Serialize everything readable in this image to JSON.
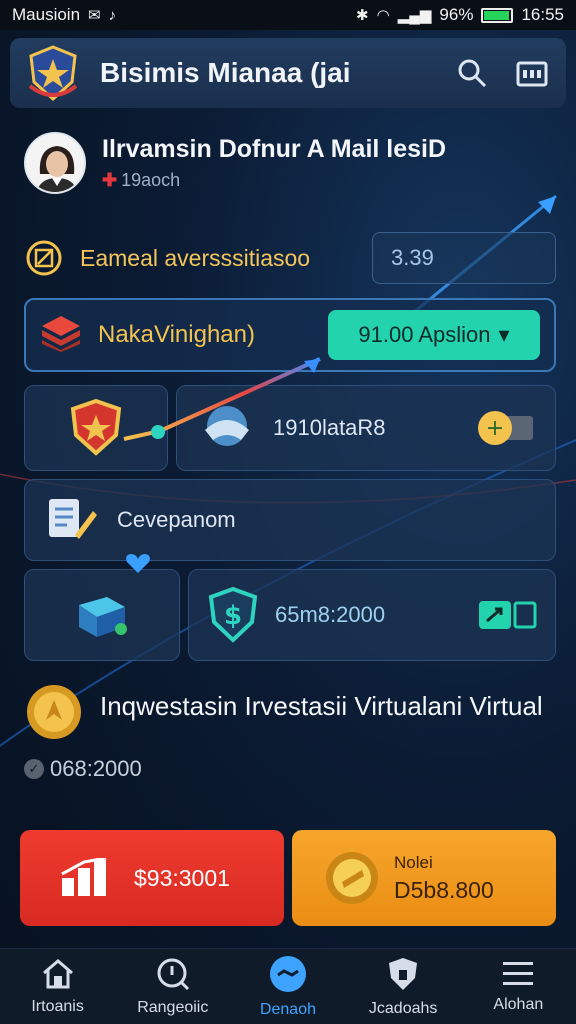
{
  "status_bar": {
    "carrier": "Mausioin",
    "battery": "96%",
    "time": "16:55"
  },
  "header": {
    "title": "Bisimis Mianaa (jai"
  },
  "profile": {
    "name": "Ilrvamsin Dofnur A Mail lesiD",
    "sub": "19aoch"
  },
  "earnings": {
    "label": "Eameal aversssitiasoo",
    "value": "3.39"
  },
  "selector": {
    "label": "NakaVinighan)",
    "button_label": "91.00 Apslion"
  },
  "tiles": {
    "amount_label": "1910lataR8",
    "cevepanom_label": "Cevepanom",
    "balance_label": "65m8:2000"
  },
  "investment": {
    "title": "Inqwestasin Irvestasii Virtualani Virtual",
    "amount": "068:2000"
  },
  "actions": {
    "red_value": "$93:3001",
    "orange_caption": "Nolei",
    "orange_value": "D5b8.800"
  },
  "nav": {
    "items": [
      {
        "label": "Irtoanis"
      },
      {
        "label": "Rangeoiic"
      },
      {
        "label": "Denaoh"
      },
      {
        "label": "Jcadoahs"
      },
      {
        "label": "Alohan"
      }
    ]
  },
  "colors": {
    "accent_teal": "#23d3ad",
    "accent_gold": "#f3c34d",
    "active_nav": "#3ea3ff",
    "red_button": "#ef3b2f",
    "orange_button": "#f7a52b"
  }
}
